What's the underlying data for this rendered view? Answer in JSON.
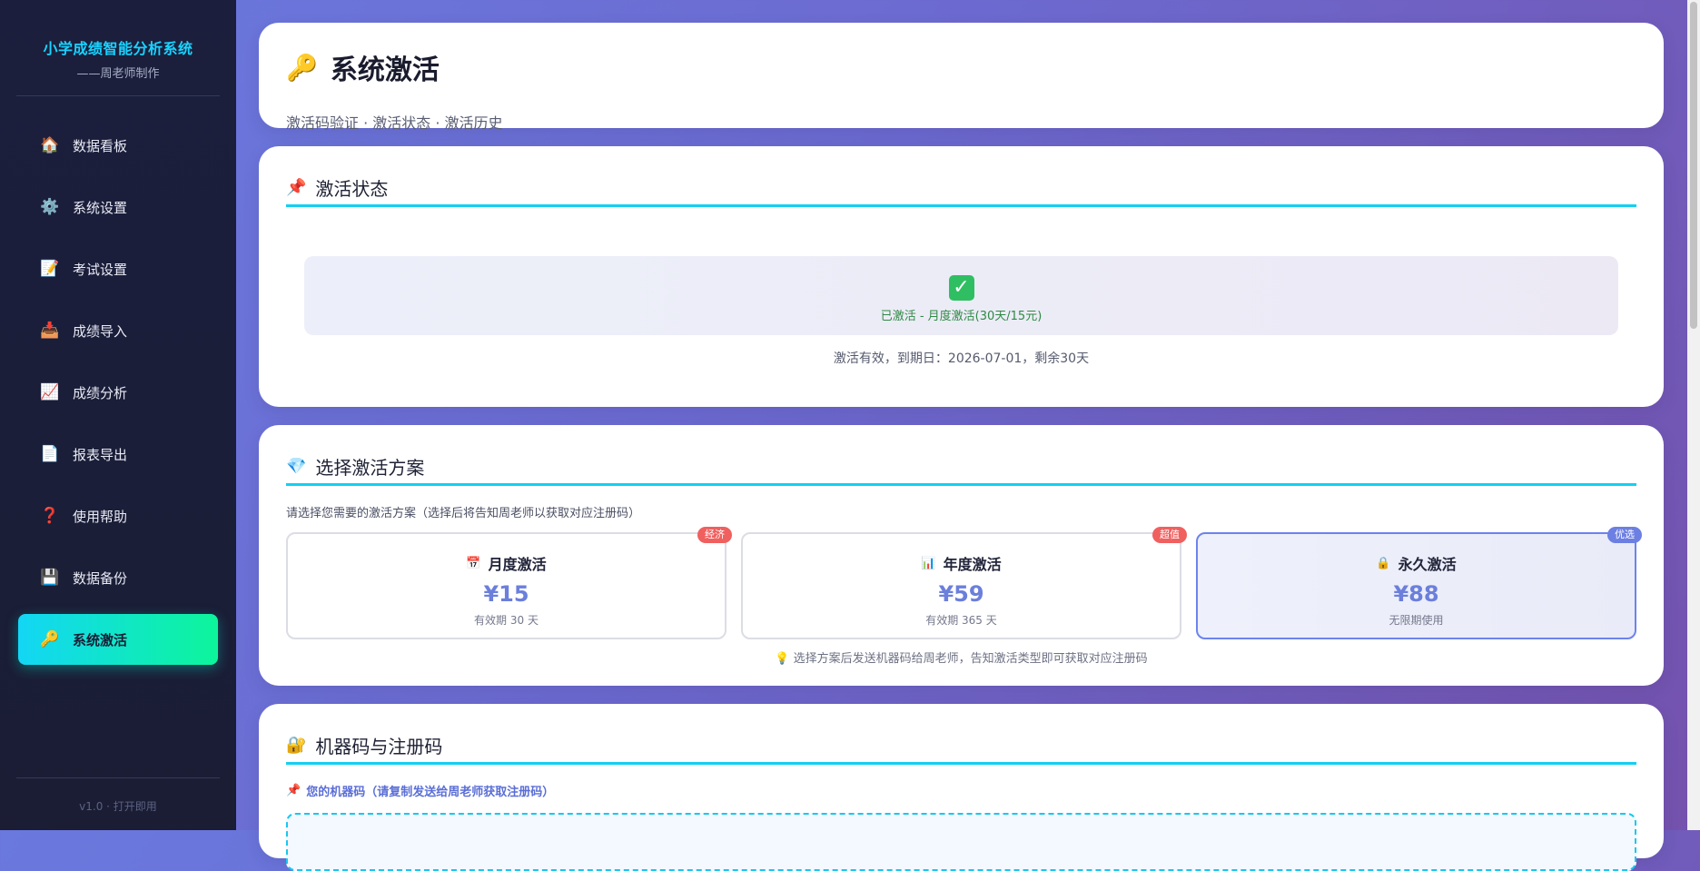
{
  "sidebar": {
    "title": "小学成绩智能分析系统",
    "subtitle": "——周老师制作",
    "items": [
      {
        "label": "数据看板",
        "icon": "🏠"
      },
      {
        "label": "系统设置",
        "icon": "⚙️"
      },
      {
        "label": "考试设置",
        "icon": "📝"
      },
      {
        "label": "成绩导入",
        "icon": "📥"
      },
      {
        "label": "成绩分析",
        "icon": "📈"
      },
      {
        "label": "报表导出",
        "icon": "📄"
      },
      {
        "label": "使用帮助",
        "icon": "❓"
      },
      {
        "label": "数据备份",
        "icon": "💾"
      },
      {
        "label": "系统激活",
        "icon": "🔑"
      }
    ],
    "active_index": 8,
    "version": "v1.0 · 打开即用"
  },
  "header": {
    "icon": "🔑",
    "title": "系统激活",
    "subtitle": "激活码验证 · 激活状态 · 激活历史"
  },
  "status_section": {
    "icon": "📌",
    "title": "激活状态",
    "status_icon": "✓",
    "status_text": "已激活 - 月度激活(30天/15元)",
    "detail": "激活有效，到期日：2026-07-01，剩余30天"
  },
  "plans_section": {
    "icon": "💎",
    "title": "选择激活方案",
    "hint": "请选择您需要的激活方案（选择后将告知周老师以获取对应注册码）",
    "plans": [
      {
        "icon": "📅",
        "name": "月度激活",
        "price": "¥15",
        "desc": "有效期 30 天",
        "badge": "经济"
      },
      {
        "icon": "📊",
        "name": "年度激活",
        "price": "¥59",
        "desc": "有效期 365 天",
        "badge": "超值"
      },
      {
        "icon": "🔒",
        "name": "永久激活",
        "price": "¥88",
        "desc": "无限期使用",
        "badge": "优选"
      }
    ],
    "selected_index": 2,
    "tip": "💡 选择方案后发送机器码给周老师，告知激活类型即可获取对应注册码"
  },
  "machine_section": {
    "icon": "🔐",
    "title": "机器码与注册码",
    "label_icon": "📌",
    "label": "您的机器码（请复制发送给周老师获取注册码）"
  },
  "colors": {
    "accent_cyan": "#12d0f2",
    "accent_green": "#0df59b",
    "price_blue": "#6b7fdb",
    "badge_red": "#f0605f"
  }
}
